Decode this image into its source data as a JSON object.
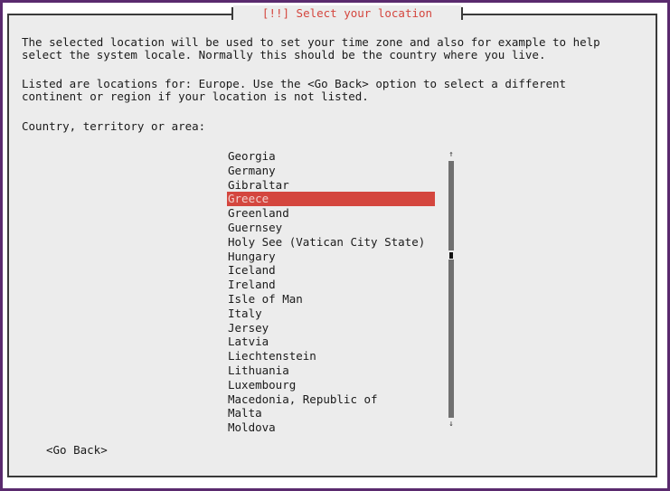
{
  "dialog": {
    "title": "[!!] Select your location",
    "description_lines": [
      "The selected location will be used to set your time zone and also for example to help",
      "select the system locale. Normally this should be the country where you live."
    ],
    "hint_lines": [
      "Listed are locations for: Europe. Use the <Go Back> option to select a different",
      "continent or region if your location is not listed."
    ],
    "list_label": "Country, territory or area:"
  },
  "countries": [
    "Georgia",
    "Germany",
    "Gibraltar",
    "Greece",
    "Greenland",
    "Guernsey",
    "Holy See (Vatican City State)",
    "Hungary",
    "Iceland",
    "Ireland",
    "Isle of Man",
    "Italy",
    "Jersey",
    "Latvia",
    "Liechtenstein",
    "Lithuania",
    "Luxembourg",
    "Macedonia, Republic of",
    "Malta",
    "Moldova"
  ],
  "selected_country": "Greece",
  "scrollbar": {
    "up_icon": "↑",
    "down_icon": "↓"
  },
  "buttons": {
    "go_back": "<Go Back>"
  },
  "colors": {
    "frame": "#5a2a6e",
    "dialog_bg": "#ececec",
    "accent": "#d4463e",
    "text": "#1a1a1a"
  }
}
